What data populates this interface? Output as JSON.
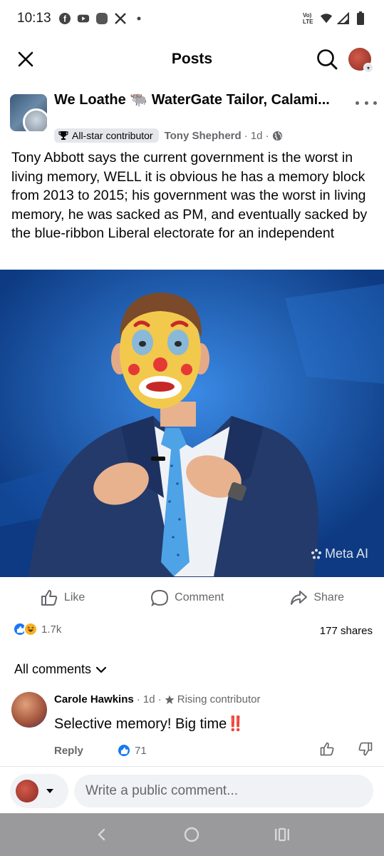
{
  "status_bar": {
    "time": "10:13",
    "lte_label": "Vo) LTE"
  },
  "header": {
    "title": "Posts"
  },
  "post": {
    "group_name": "We Loathe 🐃 WaterGate Tailor, Calami...",
    "badge": "All-star contributor",
    "author": "Tony Shepherd",
    "time": "· 1d ·",
    "text": "Tony Abbott says the current government is the worst in living memory, WELL it is obvious he has a memory block from 2013 to 2015; his government was the worst in living memory, he was sacked as PM, and eventually sacked by the blue-ribbon Liberal electorate for an independent",
    "image_watermark": "Meta AI"
  },
  "actions": {
    "like": "Like",
    "comment": "Comment",
    "share": "Share"
  },
  "stats": {
    "reactions": "1.7k",
    "shares": "177 shares"
  },
  "comments_section": {
    "filter_label": "All comments"
  },
  "comment": {
    "name": "Carole Hawkins",
    "time": "· 1d ·",
    "badge": "Rising contributor",
    "text": "Selective memory!   Big time‼️",
    "reply": "Reply",
    "likes": "71"
  },
  "composer": {
    "placeholder": "Write a public comment..."
  },
  "colors": {
    "facebook_blue": "#1877f2",
    "image_bg": "#1b5eb8",
    "nav_bar": "#9a9a9c"
  }
}
